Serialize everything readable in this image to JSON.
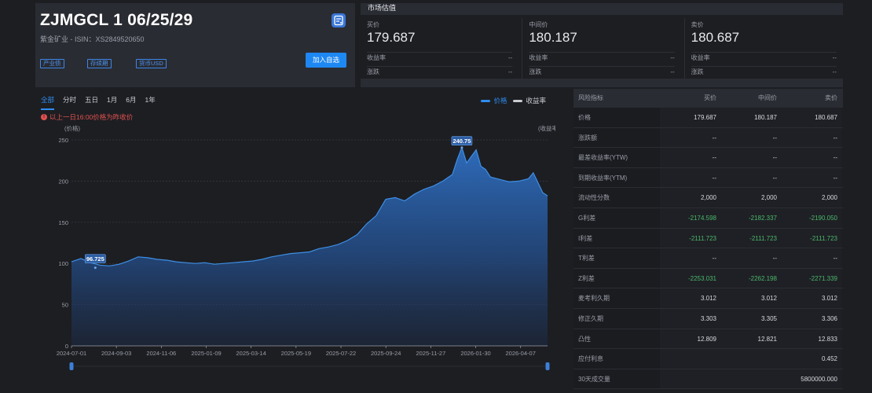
{
  "header": {
    "title": "ZJMGCL 1 06/25/29",
    "subtitle": "紫金矿业 - ISIN：XS2849520650",
    "tags": [
      "产业债",
      "存续期",
      "货币USD"
    ],
    "add_button": "加入自选"
  },
  "market": {
    "title": "市场估值",
    "columns": [
      {
        "label": "买价",
        "value": "179.687",
        "yield_label": "收益率",
        "yield": "--",
        "change_label": "涨跌",
        "change": "--"
      },
      {
        "label": "中间价",
        "value": "180.187",
        "yield_label": "收益率",
        "yield": "--",
        "change_label": "涨跌",
        "change": "--"
      },
      {
        "label": "卖价",
        "value": "180.687",
        "yield_label": "收益率",
        "yield": "--",
        "change_label": "涨跌",
        "change": "--"
      }
    ]
  },
  "chart": {
    "tabs": [
      "全部",
      "分时",
      "五日",
      "1月",
      "6月",
      "1年"
    ],
    "legend_price": "价格",
    "legend_yield": "收益率",
    "note": "以上一日16:00价格为昨收价",
    "price_color": "#2e8ef0",
    "yield_color": "#c9ccd3"
  },
  "chart_data": {
    "type": "area",
    "ylabel": "(价格)",
    "y2label": "(收益率)",
    "ylim": [
      0,
      250
    ],
    "yticks": [
      0,
      50,
      100,
      150,
      200,
      250
    ],
    "xticks": [
      "2024-07-01",
      "2024-09-03",
      "2024-11-06",
      "2025-01-09",
      "2025-03-14",
      "2025-05-19",
      "2025-07-22",
      "2025-09-24",
      "2025-11-27",
      "2026-01-30",
      "2026-04-07"
    ],
    "annotations": [
      {
        "label": "96.725",
        "x": 0.05,
        "value": 96.725
      },
      {
        "label": "240.75",
        "x": 0.82,
        "value": 240.75
      }
    ],
    "series": [
      {
        "name": "价格",
        "x": [
          0,
          0.02,
          0.04,
          0.06,
          0.08,
          0.1,
          0.12,
          0.14,
          0.16,
          0.18,
          0.2,
          0.22,
          0.24,
          0.26,
          0.28,
          0.3,
          0.32,
          0.34,
          0.36,
          0.38,
          0.4,
          0.42,
          0.44,
          0.46,
          0.48,
          0.5,
          0.52,
          0.54,
          0.56,
          0.58,
          0.6,
          0.62,
          0.64,
          0.66,
          0.68,
          0.7,
          0.72,
          0.74,
          0.76,
          0.78,
          0.8,
          0.81,
          0.82,
          0.83,
          0.84,
          0.85,
          0.86,
          0.87,
          0.88,
          0.9,
          0.92,
          0.94,
          0.96,
          0.97,
          0.98,
          0.99,
          1.0
        ],
        "values": [
          102,
          106,
          101,
          98,
          97,
          99,
          103,
          108,
          107,
          105,
          104,
          102,
          101,
          100,
          101,
          99,
          100,
          101,
          102,
          103,
          105,
          108,
          110,
          112,
          113,
          114,
          118,
          120,
          123,
          128,
          135,
          148,
          158,
          178,
          180,
          176,
          184,
          190,
          194,
          200,
          208,
          226,
          240.75,
          222,
          230,
          238,
          218,
          214,
          205,
          202,
          199,
          200,
          203,
          210,
          198,
          186,
          182
        ]
      }
    ]
  },
  "risk_table": {
    "headers": [
      "风险指标",
      "买价",
      "中间价",
      "卖价"
    ],
    "rows": [
      {
        "name": "价格",
        "values": [
          "179.687",
          "180.187",
          "180.687"
        ],
        "green": false
      },
      {
        "name": "涨跌额",
        "values": [
          "--",
          "--",
          "--"
        ],
        "green": false
      },
      {
        "name": "最差收益率(YTW)",
        "values": [
          "--",
          "--",
          "--"
        ],
        "green": false
      },
      {
        "name": "到期收益率(YTM)",
        "values": [
          "--",
          "--",
          "--"
        ],
        "green": false
      },
      {
        "name": "流动性分数",
        "values": [
          "2,000",
          "2,000",
          "2,000"
        ],
        "green": false
      },
      {
        "name": "G利差",
        "values": [
          "-2174.598",
          "-2182.337",
          "-2190.050"
        ],
        "green": true
      },
      {
        "name": "I利差",
        "values": [
          "-2111.723",
          "-2111.723",
          "-2111.723"
        ],
        "green": true
      },
      {
        "name": "T利差",
        "values": [
          "--",
          "--",
          "--"
        ],
        "green": false
      },
      {
        "name": "Z利差",
        "values": [
          "-2253.031",
          "-2262.198",
          "-2271.339"
        ],
        "green": true
      },
      {
        "name": "麦考利久期",
        "values": [
          "3.012",
          "3.012",
          "3.012"
        ],
        "green": false
      },
      {
        "name": "修正久期",
        "values": [
          "3.303",
          "3.305",
          "3.306"
        ],
        "green": false
      },
      {
        "name": "凸性",
        "values": [
          "12.809",
          "12.821",
          "12.833"
        ],
        "green": false
      },
      {
        "name": "应付利息",
        "values": [
          "",
          "",
          "0.452"
        ],
        "green": false
      },
      {
        "name": "30天成交量",
        "values": [
          "",
          "",
          "5800000.000"
        ],
        "green": false
      }
    ]
  }
}
